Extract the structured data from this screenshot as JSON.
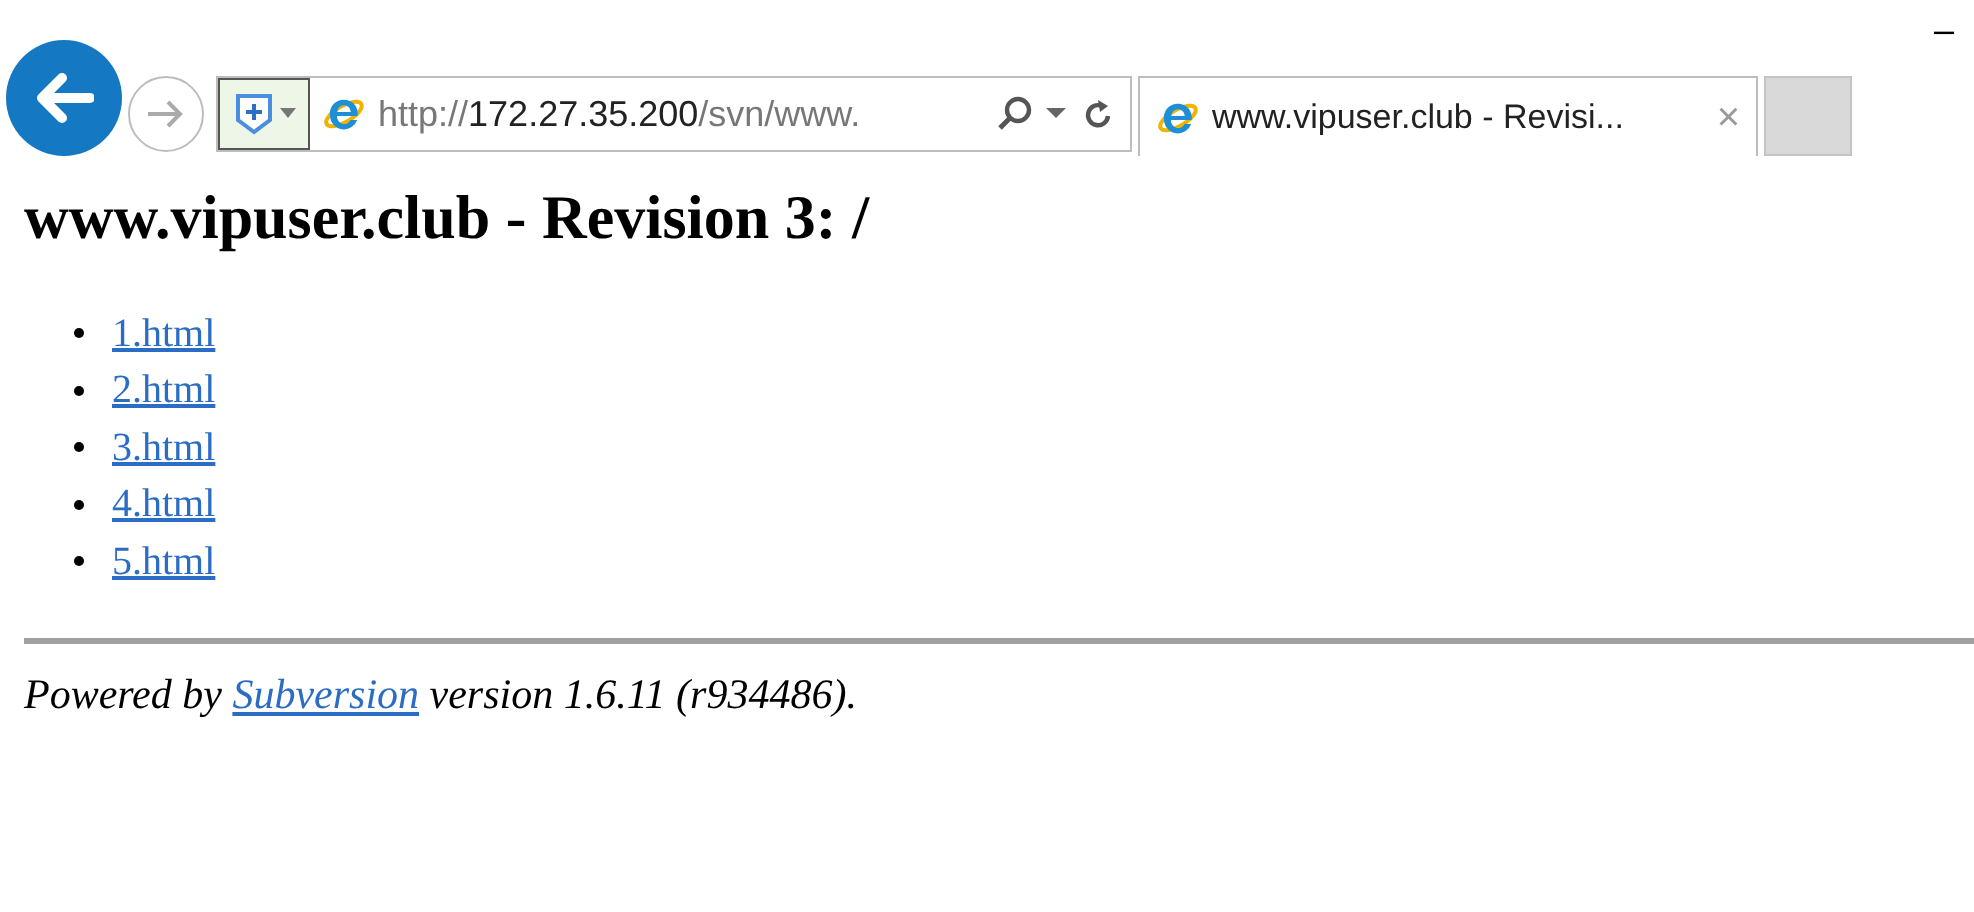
{
  "window": {
    "minimize": "–"
  },
  "address_bar": {
    "scheme": "http://",
    "host": "172.27.35.200",
    "path": "/svn/www."
  },
  "tabs": [
    {
      "title": "www.vipuser.club - Revisi...",
      "close": "×",
      "selected": true
    }
  ],
  "page": {
    "heading": "www.vipuser.club - Revision 3: /",
    "links": [
      "1.html",
      "2.html",
      "3.html",
      "4.html",
      "5.html"
    ],
    "footer": {
      "before": "Powered by ",
      "link": "Subversion",
      "after": " version 1.6.11 (r934486)."
    }
  }
}
